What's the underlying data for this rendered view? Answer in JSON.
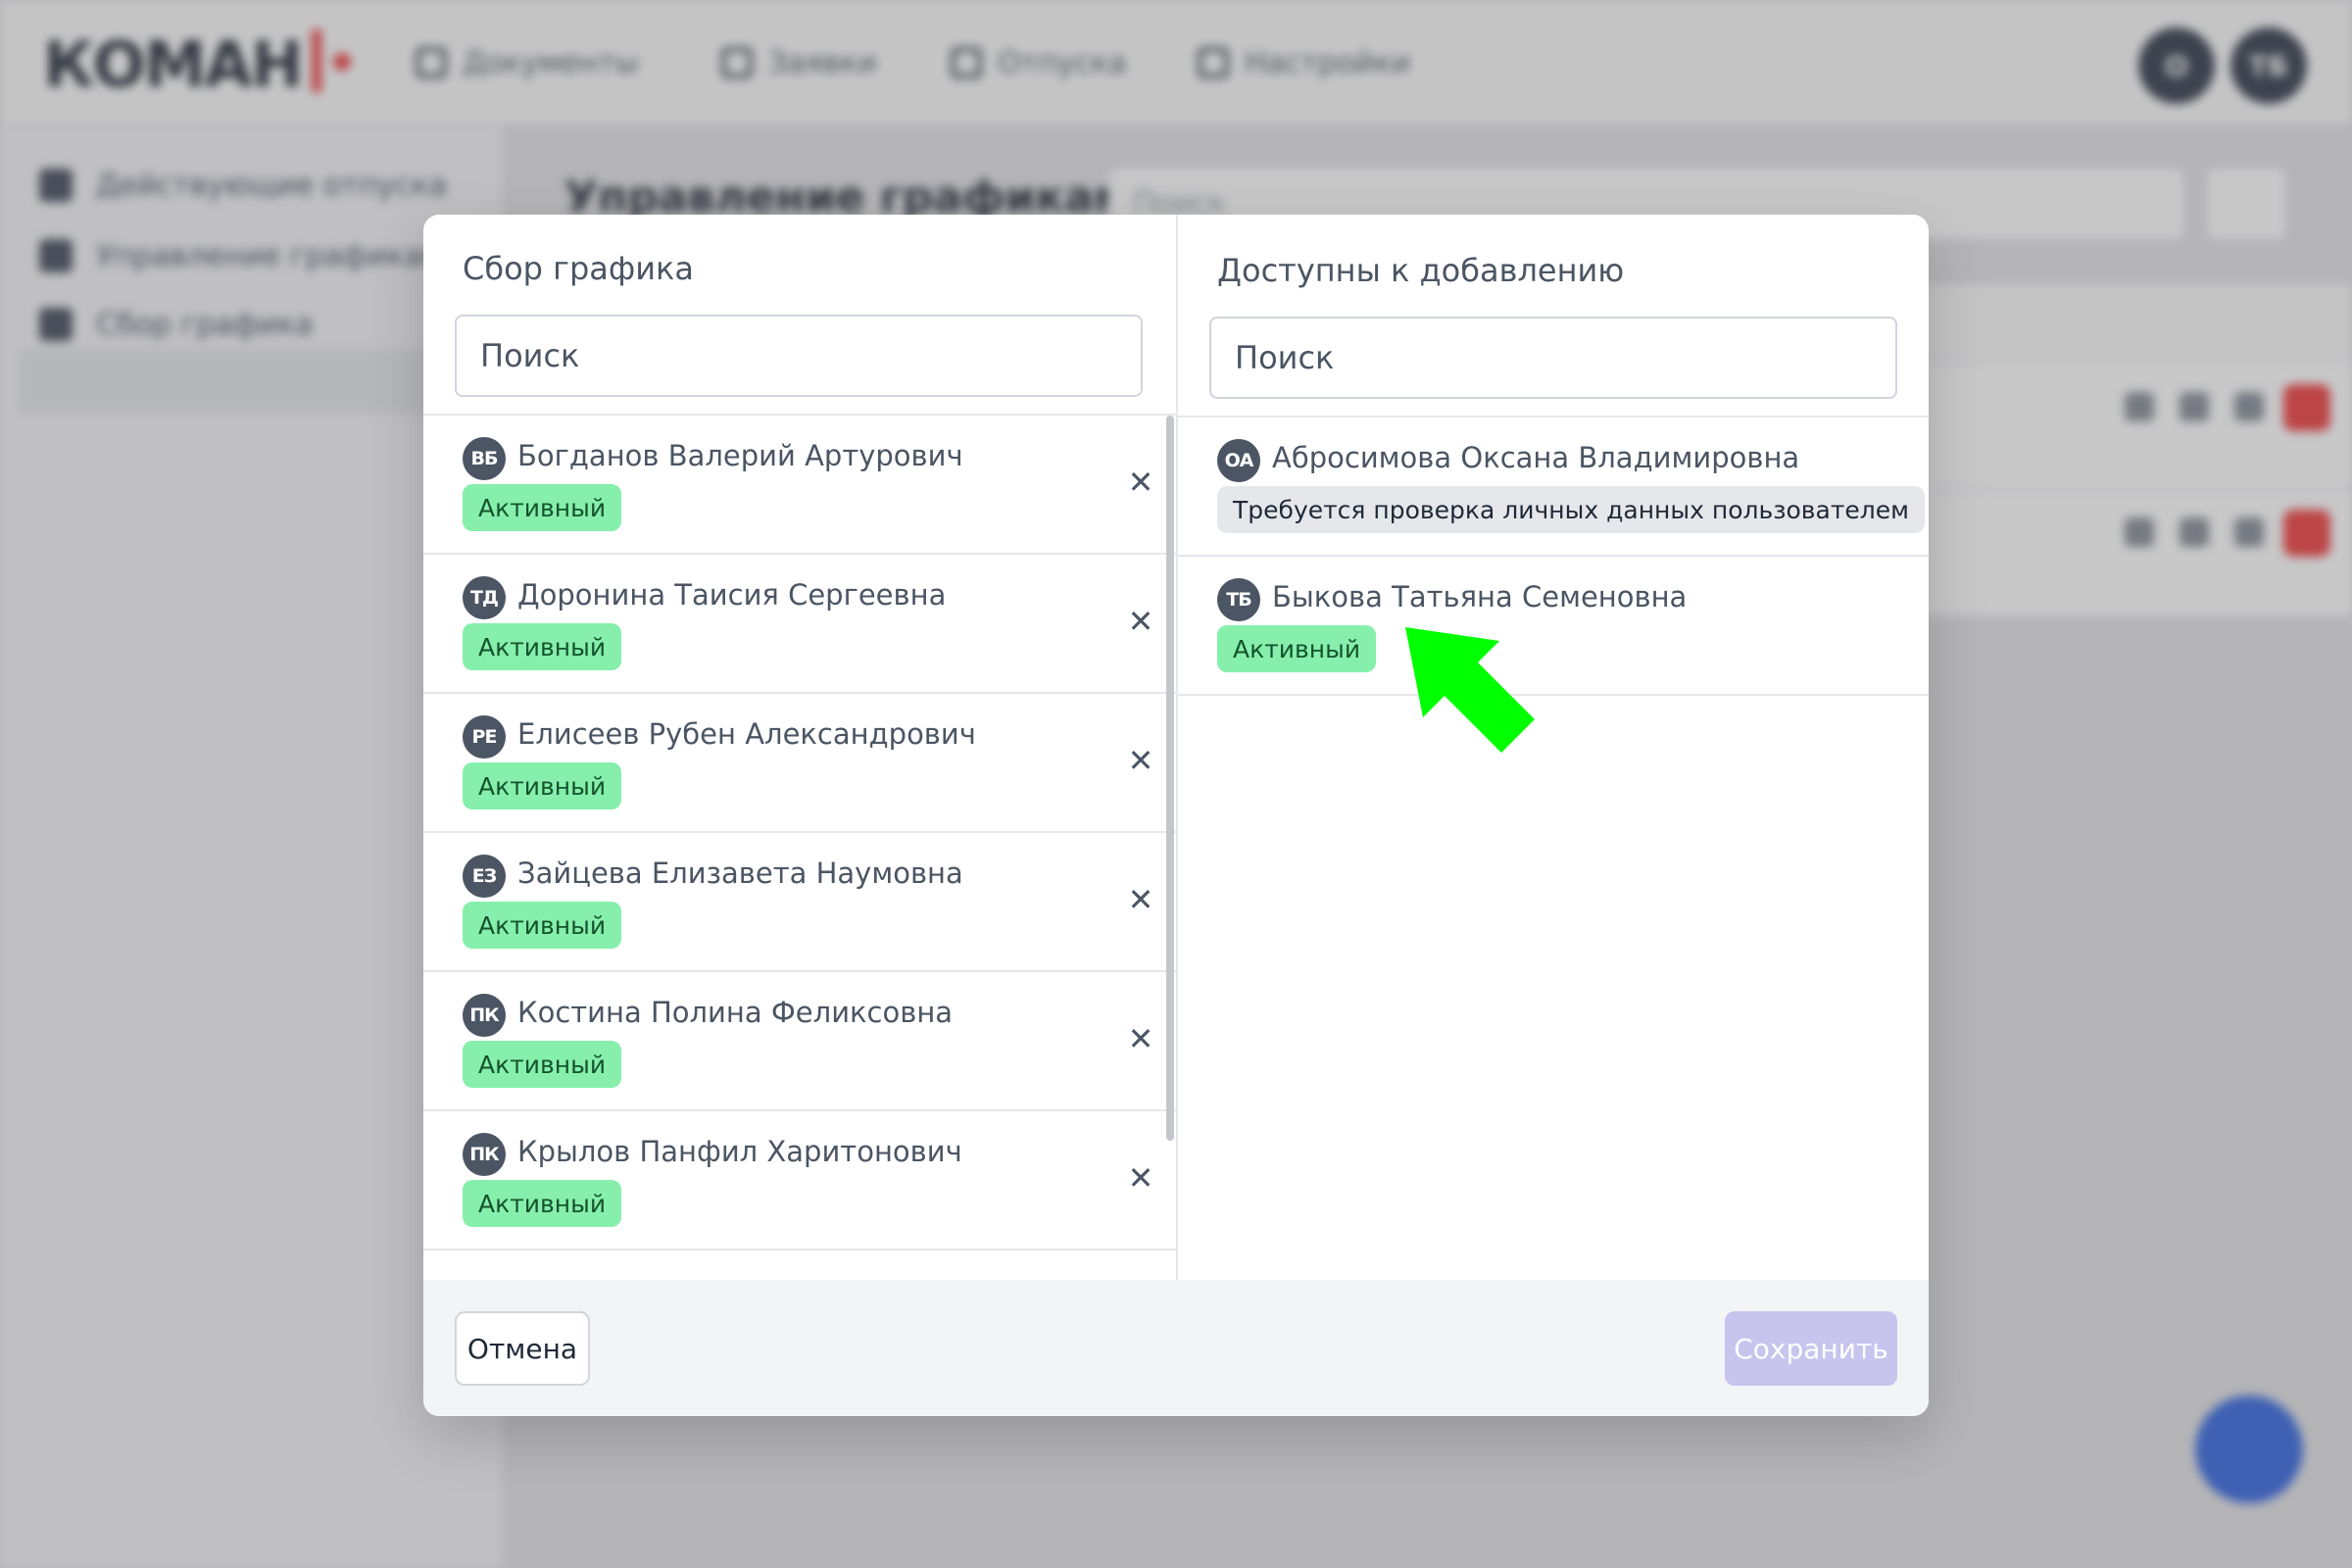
{
  "app": {
    "logo": "КОМАН",
    "nav": [
      {
        "label": "Документы",
        "icon": "document-icon"
      },
      {
        "label": "Заявки",
        "icon": "clipboard-icon"
      },
      {
        "label": "Отпуска",
        "icon": "palm-icon"
      },
      {
        "label": "Настройки",
        "icon": "settings-icon"
      }
    ],
    "avatars": [
      "О",
      "ТБ"
    ],
    "sidebar": [
      {
        "label": "Действующие отпуска"
      },
      {
        "label": "Управление графиками"
      },
      {
        "label": "Сбор графика"
      }
    ],
    "page_title": "Управление графиками",
    "search_placeholder": "Поиск"
  },
  "modal": {
    "left": {
      "title": "Сбор графика",
      "search_placeholder": "Поиск",
      "items": [
        {
          "initials": "ВБ",
          "name": "Богданов Валерий Артурович",
          "status": "Активный"
        },
        {
          "initials": "ТД",
          "name": "Доронина Таисия Сергеевна",
          "status": "Активный"
        },
        {
          "initials": "РЕ",
          "name": "Елисеев Рубен Александрович",
          "status": "Активный"
        },
        {
          "initials": "ЕЗ",
          "name": "Зайцева Елизавета Наумовна",
          "status": "Активный"
        },
        {
          "initials": "ПК",
          "name": "Костина Полина Феликсовна",
          "status": "Активный"
        },
        {
          "initials": "ПК",
          "name": "Крылов Панфил Харитонович",
          "status": "Активный"
        }
      ]
    },
    "right": {
      "title": "Доступны к добавлению",
      "search_placeholder": "Поиск",
      "items": [
        {
          "initials": "ОА",
          "name": "Абросимова Оксана Владимировна",
          "status": "Требуется проверка личных данных пользователем"
        },
        {
          "initials": "ТБ",
          "name": "Быкова Татьяна Семеновна",
          "status": "Активный"
        }
      ]
    },
    "cancel_label": "Отмена",
    "save_label": "Сохранить",
    "remove_glyph": "✕"
  },
  "colors": {
    "active_badge": "#86efac",
    "pending_badge": "#e5e7eb",
    "save_disabled": "#c7c5ee",
    "arrow": "#00ff00"
  }
}
